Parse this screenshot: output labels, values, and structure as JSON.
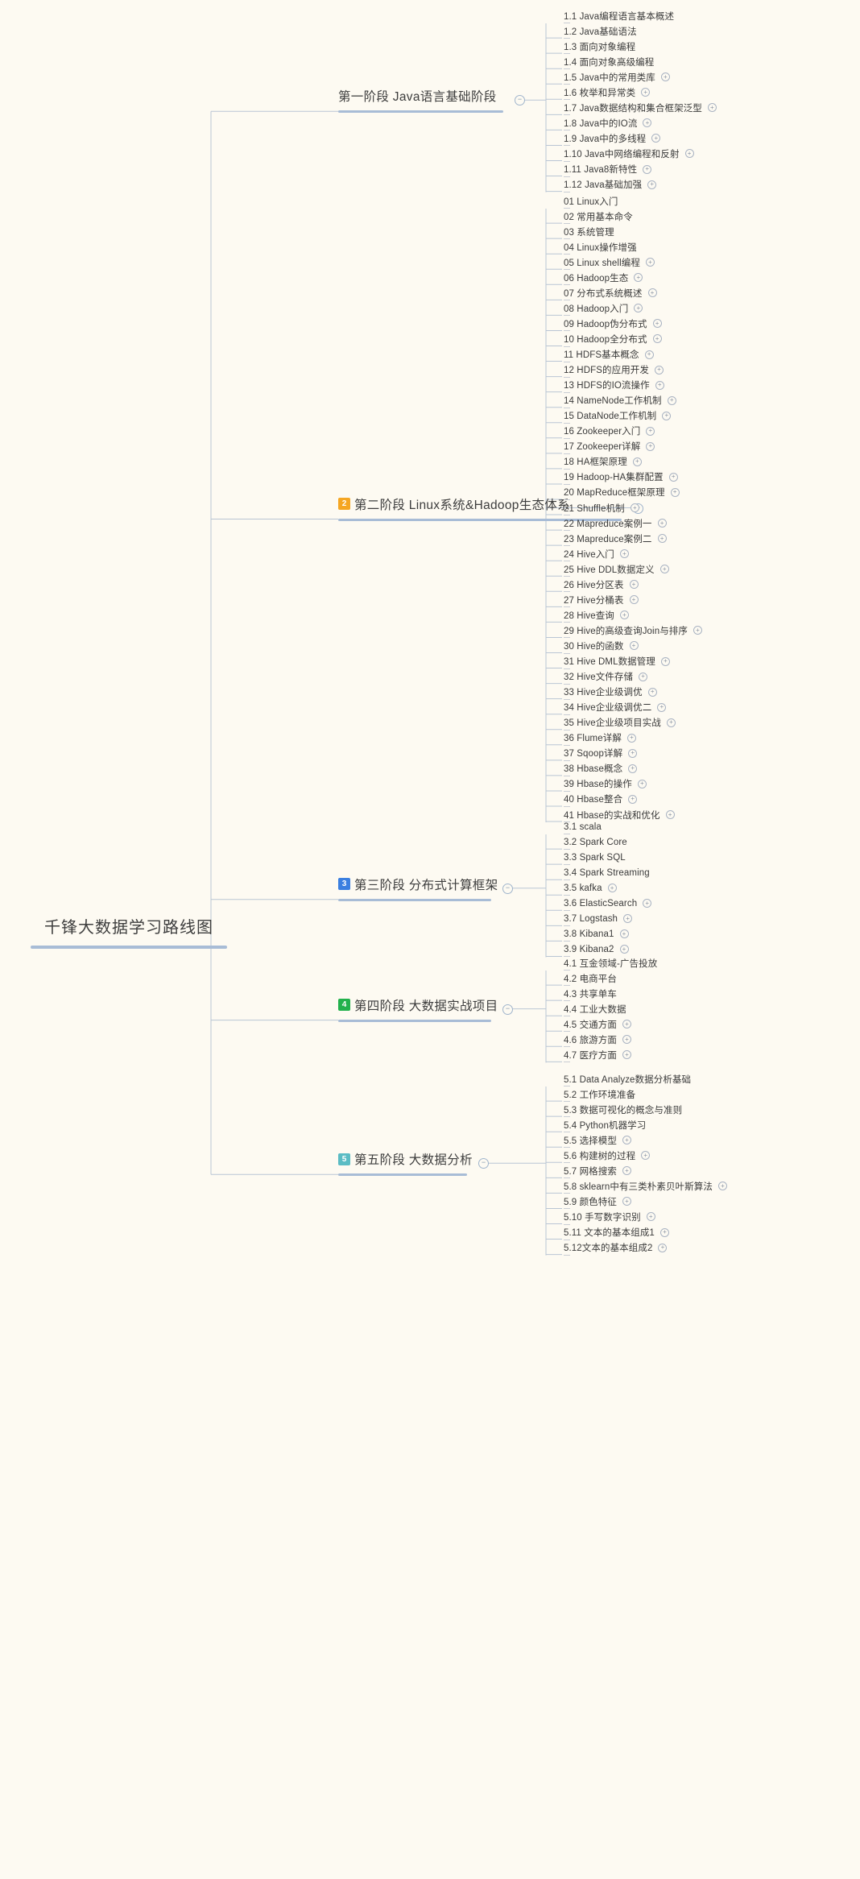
{
  "root": {
    "title": "千锋大数据学习路线图"
  },
  "colors": {
    "background": "#fdfaf2",
    "spine": "#a8bcd6",
    "connector": "#b9c5d4",
    "leaf_rule": "#c9cdd4",
    "badge_stage2": "#f5a623",
    "badge_stage3": "#3b7fe0",
    "badge_stage4": "#22b14c",
    "badge_stage5": "#5bbcc4",
    "text": "#3a3a3a"
  },
  "icons": {
    "collapse": "−",
    "expand": "+"
  },
  "stages": [
    {
      "badge": "",
      "badge_color": "",
      "label": "第一阶段 Java语言基础阶段",
      "collapsed": false,
      "items": [
        {
          "label": "1.1 Java编程语言基本概述",
          "expandable": false
        },
        {
          "label": "1.2 Java基础语法",
          "expandable": false
        },
        {
          "label": "1.3 面向对象编程",
          "expandable": false
        },
        {
          "label": "1.4 面向对象高级编程",
          "expandable": false
        },
        {
          "label": "1.5 Java中的常用类库",
          "expandable": true
        },
        {
          "label": "1.6 枚举和异常类",
          "expandable": true
        },
        {
          "label": "1.7 Java数据结构和集合框架泛型",
          "expandable": true
        },
        {
          "label": "1.8 Java中的IO流",
          "expandable": true
        },
        {
          "label": "1.9 Java中的多线程",
          "expandable": true
        },
        {
          "label": "1.10 Java中网络编程和反射",
          "expandable": true
        },
        {
          "label": "1.11 Java8新特性",
          "expandable": true
        },
        {
          "label": "1.12 Java基础加强",
          "expandable": true
        }
      ]
    },
    {
      "badge": "2",
      "badge_color": "#f5a623",
      "label": "第二阶段 Linux系统&Hadoop生态体系",
      "collapsed": false,
      "items": [
        {
          "label": "01 Linux入门",
          "expandable": false
        },
        {
          "label": "02 常用基本命令",
          "expandable": false
        },
        {
          "label": "03 系统管理",
          "expandable": false
        },
        {
          "label": "04 Linux操作增强",
          "expandable": false
        },
        {
          "label": "05 Linux shell编程",
          "expandable": true
        },
        {
          "label": "06 Hadoop生态",
          "expandable": true
        },
        {
          "label": "07 分布式系统概述",
          "expandable": true
        },
        {
          "label": "08 Hadoop入门",
          "expandable": true
        },
        {
          "label": "09 Hadoop伪分布式",
          "expandable": true
        },
        {
          "label": "10 Hadoop全分布式",
          "expandable": true
        },
        {
          "label": "11 HDFS基本概念",
          "expandable": true
        },
        {
          "label": "12 HDFS的应用开发",
          "expandable": true
        },
        {
          "label": "13 HDFS的IO流操作",
          "expandable": true
        },
        {
          "label": "14 NameNode工作机制",
          "expandable": true
        },
        {
          "label": "15 DataNode工作机制",
          "expandable": true
        },
        {
          "label": "16 Zookeeper入门",
          "expandable": true
        },
        {
          "label": "17 Zookeeper详解",
          "expandable": true
        },
        {
          "label": "18 HA框架原理",
          "expandable": true
        },
        {
          "label": "19 Hadoop-HA集群配置",
          "expandable": true
        },
        {
          "label": "20 MapReduce框架原理",
          "expandable": true
        },
        {
          "label": "21 Shuffle机制",
          "expandable": true
        },
        {
          "label": "22 Mapreduce案例一",
          "expandable": true
        },
        {
          "label": "23 Mapreduce案例二",
          "expandable": true
        },
        {
          "label": "24 Hive入门",
          "expandable": true
        },
        {
          "label": "25 Hive DDL数据定义",
          "expandable": true
        },
        {
          "label": "26 Hive分区表",
          "expandable": true
        },
        {
          "label": "27 Hive分桶表",
          "expandable": true
        },
        {
          "label": "28 Hive查询",
          "expandable": true
        },
        {
          "label": "29 Hive的高级查询Join与排序",
          "expandable": true
        },
        {
          "label": "30 Hive的函数",
          "expandable": true
        },
        {
          "label": "31 Hive DML数据管理",
          "expandable": true
        },
        {
          "label": "32 Hive文件存储",
          "expandable": true
        },
        {
          "label": "33 Hive企业级调优",
          "expandable": true
        },
        {
          "label": "34 Hive企业级调优二",
          "expandable": true
        },
        {
          "label": "35 Hive企业级项目实战",
          "expandable": true
        },
        {
          "label": "36 Flume详解",
          "expandable": true
        },
        {
          "label": "37 Sqoop详解",
          "expandable": true
        },
        {
          "label": "38 Hbase概念",
          "expandable": true
        },
        {
          "label": "39 Hbase的操作",
          "expandable": true
        },
        {
          "label": "40 Hbase整合",
          "expandable": true
        },
        {
          "label": "41 Hbase的实战和优化",
          "expandable": true
        }
      ]
    },
    {
      "badge": "3",
      "badge_color": "#3b7fe0",
      "label": "第三阶段 分布式计算框架",
      "collapsed": false,
      "items": [
        {
          "label": "3.1 scala",
          "expandable": false
        },
        {
          "label": "3.2 Spark Core",
          "expandable": false
        },
        {
          "label": "3.3 Spark SQL",
          "expandable": false
        },
        {
          "label": "3.4 Spark Streaming",
          "expandable": false
        },
        {
          "label": "3.5 kafka",
          "expandable": true
        },
        {
          "label": "3.6 ElasticSearch",
          "expandable": true
        },
        {
          "label": "3.7 Logstash",
          "expandable": true
        },
        {
          "label": "3.8 Kibana1",
          "expandable": true
        },
        {
          "label": "3.9 Kibana2",
          "expandable": true
        }
      ]
    },
    {
      "badge": "4",
      "badge_color": "#22b14c",
      "label": "第四阶段 大数据实战项目",
      "collapsed": false,
      "items": [
        {
          "label": "4.1 互金领域-广告投放",
          "expandable": false
        },
        {
          "label": "4.2 电商平台",
          "expandable": false
        },
        {
          "label": "4.3 共享单车",
          "expandable": false
        },
        {
          "label": "4.4 工业大数据",
          "expandable": false
        },
        {
          "label": "4.5 交通方面",
          "expandable": true
        },
        {
          "label": "4.6 旅游方面",
          "expandable": true
        },
        {
          "label": "4.7 医疗方面",
          "expandable": true
        }
      ]
    },
    {
      "badge": "5",
      "badge_color": "#5bbcc4",
      "label": "第五阶段 大数据分析",
      "collapsed": false,
      "items": [
        {
          "label": "5.1 Data Analyze数据分析基础",
          "expandable": false
        },
        {
          "label": "5.2 工作环境准备",
          "expandable": false
        },
        {
          "label": "5.3 数据可视化的概念与准则",
          "expandable": false
        },
        {
          "label": "5.4 Python机器学习",
          "expandable": false
        },
        {
          "label": "5.5 选择模型",
          "expandable": true
        },
        {
          "label": "5.6 构建树的过程",
          "expandable": true
        },
        {
          "label": "5.7 网格搜索",
          "expandable": true
        },
        {
          "label": "5.8 sklearn中有三类朴素贝叶斯算法",
          "expandable": true
        },
        {
          "label": "5.9 颜色特征",
          "expandable": true
        },
        {
          "label": "5.10 手写数字识别",
          "expandable": true
        },
        {
          "label": "5.11 文本的基本组成1",
          "expandable": true
        },
        {
          "label": "5.12文本的基本组成2",
          "expandable": true
        }
      ]
    }
  ]
}
